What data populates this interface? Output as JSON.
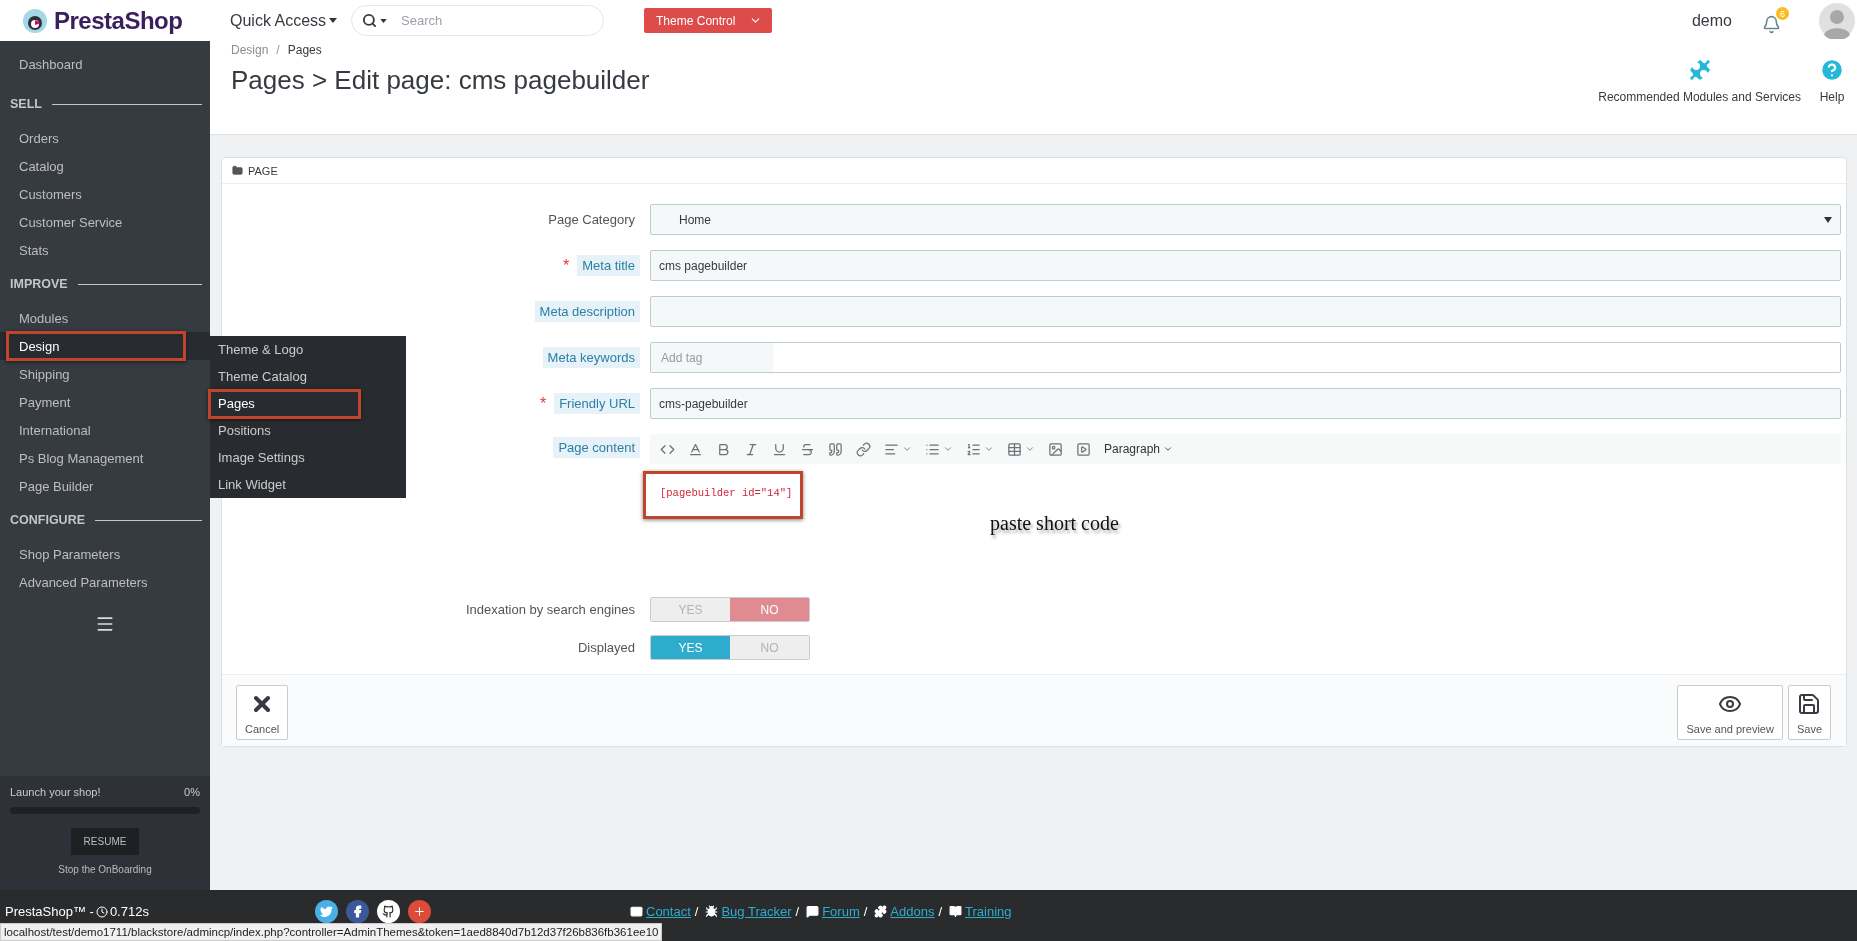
{
  "header": {
    "logo": "PrestaShop",
    "quick_access": "Quick Access",
    "search": {
      "placeholder": "Search"
    },
    "theme_control": "Theme Control",
    "user": "demo",
    "notifications": "6"
  },
  "sidebar": {
    "sections": [
      {
        "items": [
          {
            "label": "Dashboard",
            "selected": false
          }
        ]
      },
      {
        "title": "SELL",
        "items": [
          {
            "label": "Orders",
            "selected": false
          },
          {
            "label": "Catalog",
            "selected": false
          },
          {
            "label": "Customers",
            "selected": false
          },
          {
            "label": "Customer Service",
            "selected": false
          },
          {
            "label": "Stats",
            "selected": false
          }
        ]
      },
      {
        "title": "IMPROVE",
        "items": [
          {
            "label": "Modules",
            "selected": false
          },
          {
            "label": "Design",
            "selected": true
          },
          {
            "label": "Shipping",
            "selected": false
          },
          {
            "label": "Payment",
            "selected": false
          },
          {
            "label": "International",
            "selected": false
          },
          {
            "label": "Ps Blog Management",
            "selected": false
          },
          {
            "label": "Page Builder",
            "selected": false
          }
        ]
      },
      {
        "title": "CONFIGURE",
        "items": [
          {
            "label": "Shop Parameters",
            "selected": false
          },
          {
            "label": "Advanced Parameters",
            "selected": false
          }
        ]
      }
    ],
    "submenu": [
      {
        "label": "Theme & Logo",
        "selected": false
      },
      {
        "label": "Theme Catalog",
        "selected": false
      },
      {
        "label": "Pages",
        "selected": true
      },
      {
        "label": "Positions",
        "selected": false
      },
      {
        "label": "Image Settings",
        "selected": false
      },
      {
        "label": "Link Widget",
        "selected": false
      }
    ],
    "onboarding": {
      "label": "Launch your shop!",
      "percent": "0%",
      "level": 0,
      "button": "RESUME",
      "link": "Stop the OnBoarding"
    }
  },
  "breadcrumbs": [
    "Design",
    "Pages"
  ],
  "breadcrumb_separator": "/",
  "page_title": "Pages > Edit page: cms pagebuilder",
  "toolbar": [
    {
      "kind": "modules",
      "label": "Recommended Modules and Services"
    },
    {
      "kind": "help",
      "label": "Help"
    }
  ],
  "panel": {
    "title": "PAGE",
    "required_mark": "*",
    "fields": [
      {
        "kind": "select",
        "label": "Page Category",
        "required": false,
        "hint": false,
        "value": "Home"
      },
      {
        "kind": "text",
        "label": "Meta title",
        "required": true,
        "hint": true,
        "value": "cms pagebuilder"
      },
      {
        "kind": "text",
        "label": "Meta description",
        "required": false,
        "hint": true
      },
      {
        "kind": "tags",
        "label": "Meta keywords",
        "required": false,
        "hint": true,
        "placeholder": "Add tag"
      },
      {
        "kind": "text",
        "label": "Friendly URL",
        "required": true,
        "hint": true,
        "value": "cms-pagebuilder"
      },
      {
        "kind": "editor",
        "label": "Page content",
        "required": false,
        "hint": true,
        "format": "Paragraph",
        "content": "[pagebuilder id=\"14\"]"
      }
    ],
    "switches": [
      {
        "label": "Indexation by search engines",
        "options": [
          {
            "label": "YES",
            "selected": false
          },
          {
            "label": "NO",
            "selected": true
          }
        ]
      },
      {
        "label": "Displayed",
        "options": [
          {
            "label": "YES",
            "selected": true
          },
          {
            "label": "NO",
            "selected": false
          }
        ]
      }
    ],
    "buttons": [
      {
        "kind": "cancel",
        "label": "Cancel"
      },
      {
        "kind": "preview",
        "label": "Save and preview"
      },
      {
        "kind": "save",
        "label": "Save"
      }
    ]
  },
  "annotation": "paste short code",
  "footer": {
    "brand": "PrestaShop™ - ",
    "time": "0.712s",
    "social": [
      {
        "kind": "twitter"
      },
      {
        "kind": "facebook"
      },
      {
        "kind": "github"
      },
      {
        "kind": "google"
      }
    ],
    "links": [
      {
        "kind": "contact",
        "label": "Contact"
      },
      {
        "kind": "bug",
        "label": "Bug Tracker"
      },
      {
        "kind": "forum",
        "label": "Forum"
      },
      {
        "kind": "addons",
        "label": "Addons"
      },
      {
        "kind": "training",
        "label": "Training"
      }
    ],
    "separator": "/"
  },
  "status_url": "localhost/test/demo1711/blackstore/admincp/index.php?controller=AdminThemes&token=1aed8840d7b12d37f26b836fb361ee10"
}
